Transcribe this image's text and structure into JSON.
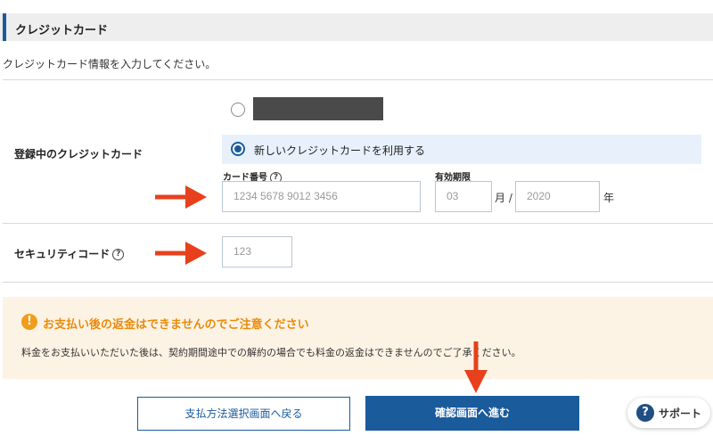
{
  "section": {
    "title": "クレジットカード"
  },
  "intro": "クレジットカード情報を入力してください。",
  "registered_card": {
    "label": "登録中のクレジットカード",
    "new_card_option": "新しいクレジットカードを利用する"
  },
  "card_number": {
    "label": "カード番号",
    "placeholder": "1234 5678 9012 3456"
  },
  "expiry": {
    "label": "有効期限",
    "month_placeholder": "03",
    "month_suffix": "月 /",
    "year_placeholder": "2020",
    "year_suffix": "年"
  },
  "security_code": {
    "label": "セキュリティコード",
    "placeholder": "123"
  },
  "help_icon_glyph": "?",
  "notice": {
    "icon_glyph": "!",
    "heading": "お支払い後の返金はできませんのでご注意ください",
    "body": "料金をお支払いいただいた後は、契約期間途中での解約の場合でも料金の返金はできませんのでご了承ください。"
  },
  "buttons": {
    "back": "支払方法選択画面へ戻る",
    "confirm": "確認画面へ進む"
  },
  "support": {
    "icon_glyph": "?",
    "label": "サポート"
  },
  "colors": {
    "accent": "#1a5b9c",
    "warning": "#ea8b0c",
    "notice_bg": "#fdf3e4",
    "arrow": "#e8401c"
  }
}
